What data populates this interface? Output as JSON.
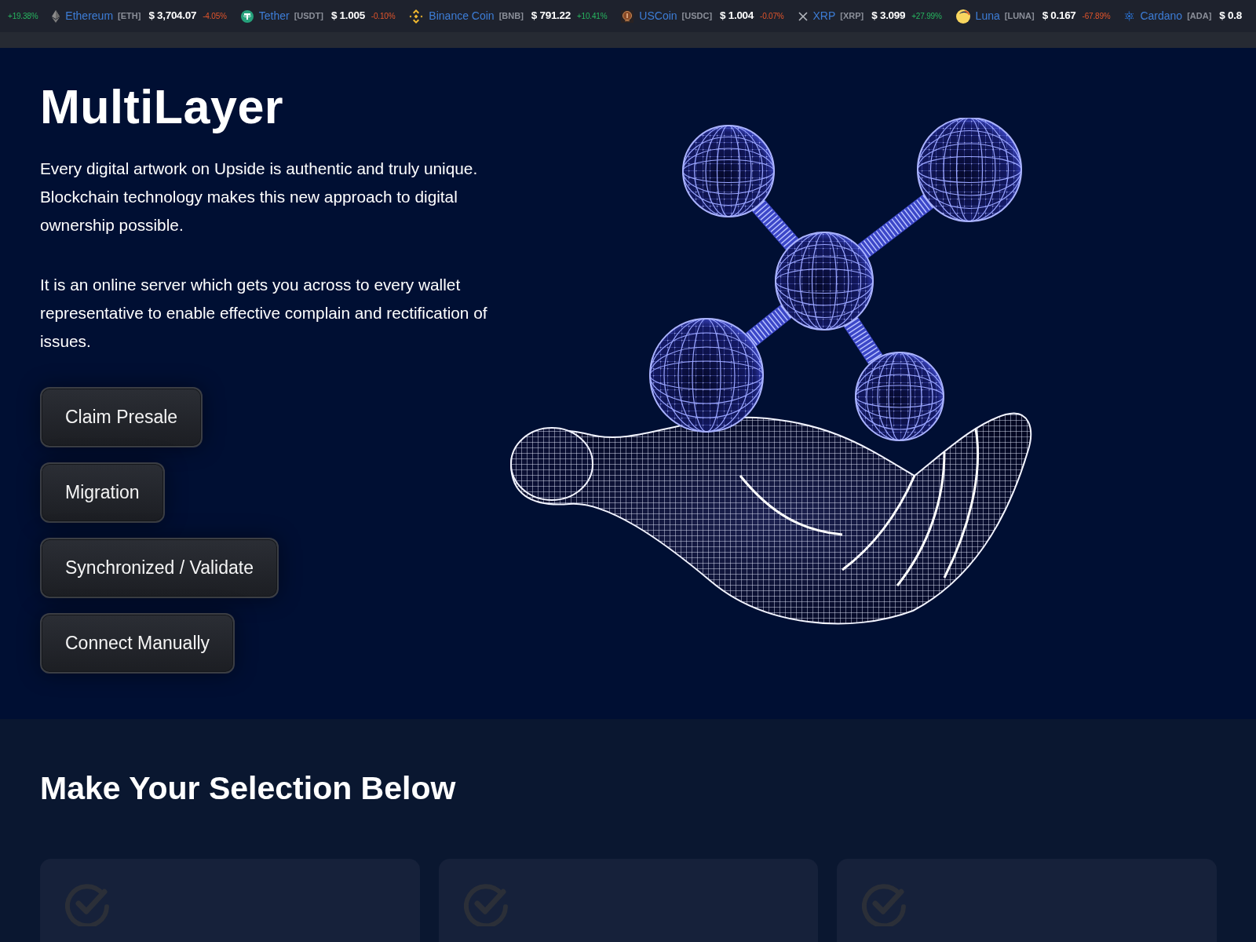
{
  "ticker": [
    {
      "change": "+19.38%",
      "rising": true
    },
    {
      "kind": "diamond",
      "name": "Ethereum",
      "symbol": "[ETH]",
      "price": "$ 3,704.07",
      "change": "-4.05%",
      "rising": false
    },
    {
      "kind": "t-coin",
      "name": "Tether",
      "symbol": "[USDT]",
      "price": "$ 1.005",
      "change": "-0.10%",
      "rising": false
    },
    {
      "kind": "diamond-grid",
      "name": "Binance Coin",
      "symbol": "[BNB]",
      "price": "$ 791.22",
      "change": "+10.41%",
      "rising": true
    },
    {
      "kind": "coin",
      "name": "USCoin",
      "symbol": "[USDC]",
      "price": "$ 1.004",
      "change": "-0.07%",
      "rising": false
    },
    {
      "kind": "cross",
      "name": "XRP",
      "symbol": "[XRP]",
      "price": "$ 3.099",
      "change": "+27.99%",
      "rising": true
    },
    {
      "kind": "crescent",
      "name": "Luna",
      "symbol": "[LUNA]",
      "price": "$ 0.167",
      "change": "-67.89%",
      "rising": false
    },
    {
      "kind": "dots",
      "name": "Cardano",
      "symbol": "[ADA]",
      "price": "$ 0.8"
    }
  ],
  "hero": {
    "title": "MultiLayer",
    "paragraphs": [
      "Every digital artwork on Upside is authentic and truly unique. Blockchain technology makes this new approach to digital ownership possible.",
      "It is an online server which gets you across to every wallet representative to enable effective complain and rectification of issues."
    ],
    "buttons": [
      "Claim Presale",
      "Migration",
      "Synchronized / Validate",
      "Connect Manually"
    ]
  },
  "selection": {
    "heading": "Make Your Selection Below",
    "cards": [
      {
        "kind": "check"
      },
      {
        "kind": "check"
      },
      {
        "kind": "check"
      }
    ]
  }
}
